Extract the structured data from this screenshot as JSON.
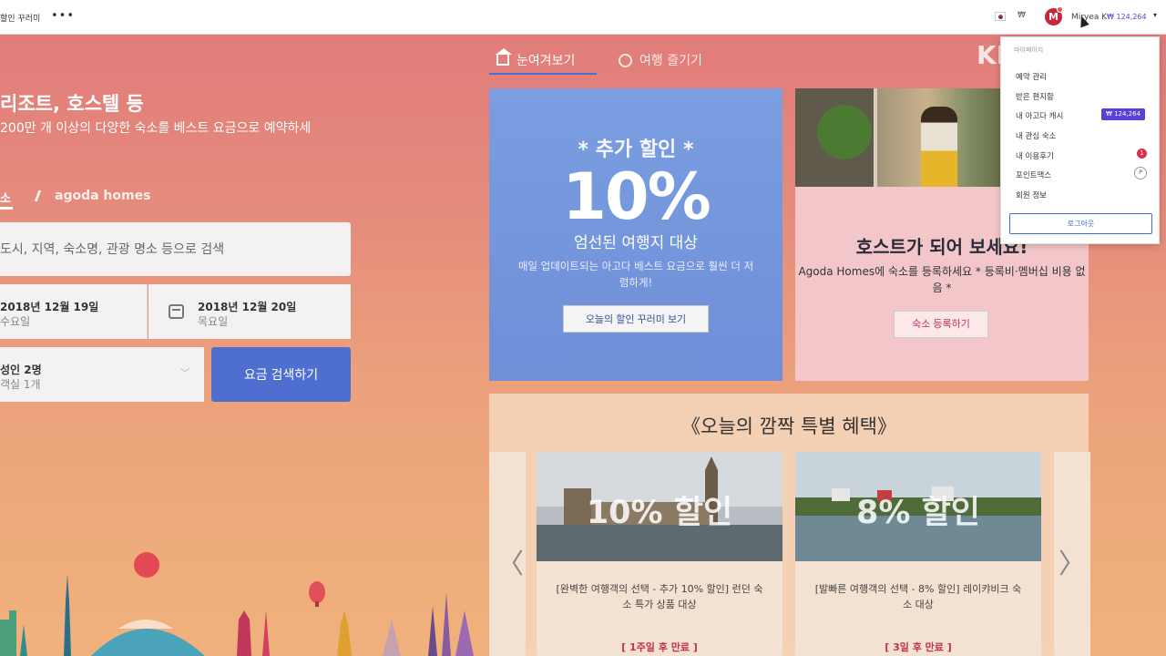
{
  "topbar": {
    "left_link": "할인 꾸러미",
    "more": "•••",
    "avatar_letter": "M",
    "username": "Miryea K",
    "cash": "₩ 124,264",
    "caret": "▾",
    "currency_caret": "₩"
  },
  "hero": {
    "title": "리조트, 호스텔 등",
    "subtitle": "200만 개 이상의 다양한 숙소를 베스트 요금으로 예약하세",
    "tab_hotel": "소",
    "tab_homes": "agoda homes"
  },
  "search": {
    "placeholder": "도시, 지역, 숙소명, 관광 명소 등으로 검색",
    "checkin_date": "2018년 12월 19일",
    "checkin_day": "수요일",
    "checkout_date": "2018년 12월 20일",
    "checkout_day": "목요일",
    "guests": "성인 2명",
    "rooms": "객실 1개",
    "button": "요금 검색하기"
  },
  "center_tabs": {
    "tab1": "눈여겨보기",
    "tab2": "여행 즐기기"
  },
  "promo": {
    "kicker": "* 추가 할인 *",
    "big": "10%",
    "note": "엄선된 여행지 대상",
    "desc": "매일 업데이트되는 아고다 베스트 요금으로 훨씬 더 저렴하게!",
    "button": "오늘의 할인 꾸러미 보기"
  },
  "host": {
    "title": "호스트가 되어 보세요!",
    "sub": "Agoda Homes에 숙소를 등록하세요 * 등록비·멤버십 비용 없음 *",
    "button": "숙소 등록하기"
  },
  "deals": {
    "title": "《오늘의 깜짝 특별 혜택》",
    "cards": [
      {
        "pct": "10% 할인",
        "desc": "[완벽한 여행객의 선택 - 추가 10% 할인] 런던 숙소 특가 상품 대상",
        "expires": "[ 1주일 후 만료 ]"
      },
      {
        "pct": "8% 할인",
        "desc": "[발빠른 여행객의 선택 - 8% 할인] 레이캬비크 숙소 대상",
        "expires": "[ 3일 후 만료 ]"
      }
    ],
    "prev": "〈",
    "next": "〉"
  },
  "watermark": "KBS",
  "dropdown": {
    "header": "마이페이지",
    "items": [
      "예약 관리",
      "받은 편지함",
      "내 아고다 캐시",
      "내 관심 숙소",
      "내 이용후기",
      "포인트맥스",
      "회원 정보"
    ],
    "cash_value": "₩ 124,264",
    "review_badge": "1",
    "points_label": "P",
    "logout": "로그아웃"
  },
  "colors": {
    "accent_blue": "#4f6fd0",
    "brand_red": "#c2314f",
    "cash_purple": "#5b3fd8"
  }
}
